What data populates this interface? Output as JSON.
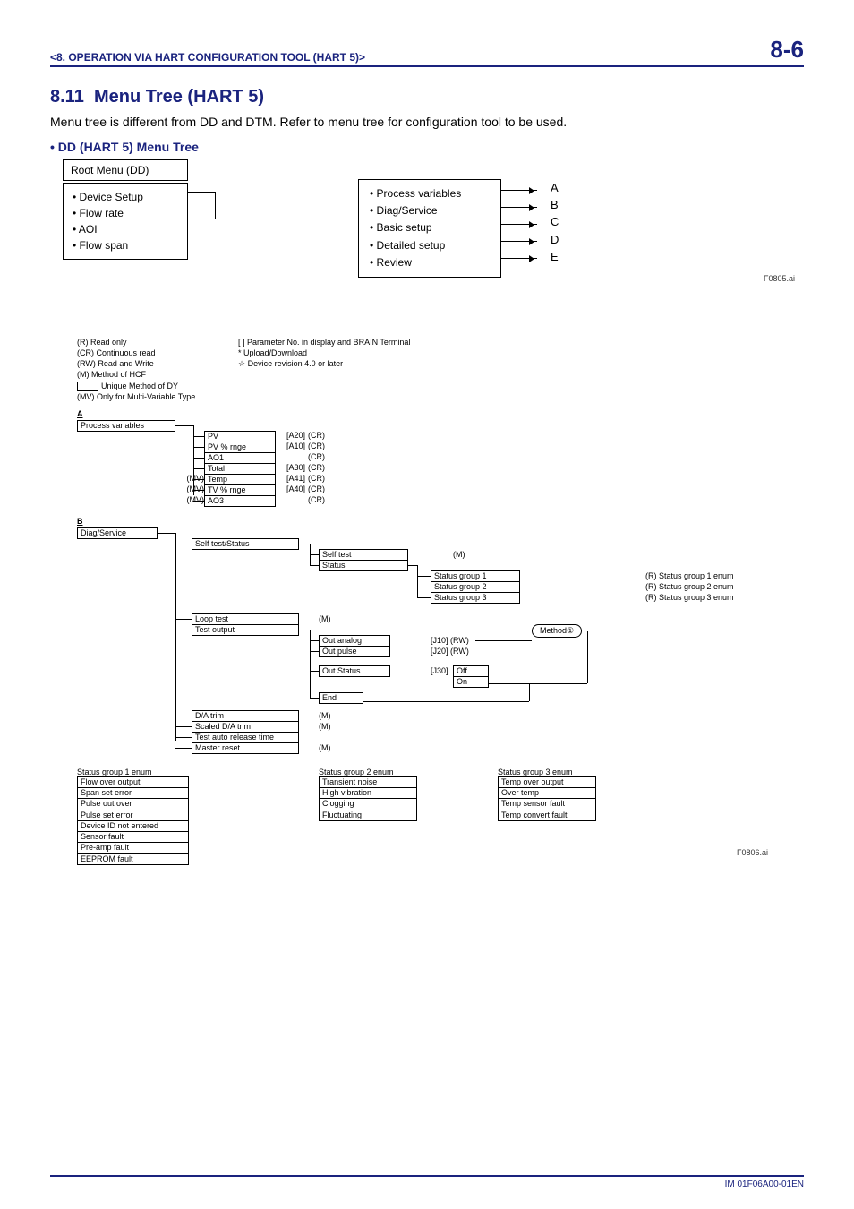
{
  "header": {
    "chapter": "<8.  OPERATION VIA HART CONFIGURATION TOOL (HART 5)>",
    "page": "8-6"
  },
  "section": {
    "num": "8.11",
    "title": "Menu Tree (HART 5)"
  },
  "intro": "Menu tree is different from DD and DTM. Refer to menu tree for configuration tool to be used.",
  "dd_heading": "• DD (HART 5) Menu Tree",
  "root": {
    "title": "Root Menu (DD)",
    "items": [
      "• Device Setup",
      "• Flow rate",
      "• AOI",
      "• Flow span"
    ]
  },
  "device_setup": {
    "items": [
      "• Process variables",
      "• Diag/Service",
      "• Basic setup",
      "• Detailed setup",
      "• Review"
    ],
    "letters": [
      "A",
      "B",
      "C",
      "D",
      "E"
    ]
  },
  "fig_labels": {
    "top": "F0805.ai",
    "bottom": "F0806.ai"
  },
  "legend": {
    "left": [
      "(R) Read only",
      "(CR) Continuous read",
      "(RW) Read and Write",
      "(M) Method of HCF"
    ],
    "left_box": "Unique Method of DY",
    "left_mv": "(MV) Only for Multi-Variable Type",
    "right": [
      "[   ] Parameter No. in display and BRAIN Terminal",
      "*  Upload/Download",
      "☆ Device revision 4.0 or later"
    ]
  },
  "sectionA": {
    "label": "A",
    "title": "Process variables",
    "rows": [
      {
        "mv": "",
        "name": "PV",
        "code": "[A20]",
        "rw": "(CR)"
      },
      {
        "mv": "",
        "name": "PV % rnge",
        "code": "[A10]",
        "rw": "(CR)"
      },
      {
        "mv": "",
        "name": "AO1",
        "code": "",
        "rw": "(CR)"
      },
      {
        "mv": "",
        "name": "Total",
        "code": "[A30]",
        "rw": "(CR)"
      },
      {
        "mv": "(MV)",
        "name": "Temp",
        "code": "[A41]",
        "rw": "(CR)"
      },
      {
        "mv": "(MV)",
        "name": "TV % rnge",
        "code": "[A40]",
        "rw": "(CR)"
      },
      {
        "mv": "(MV)",
        "name": "AO3",
        "code": "",
        "rw": "(CR)"
      }
    ]
  },
  "sectionB": {
    "label": "B",
    "title": "Diag/Service",
    "selftest_status": "Self test/Status",
    "selftest": "Self test",
    "selftest_m": "(M)",
    "status": "Status",
    "status_groups": [
      {
        "n": "Status group 1",
        "r": "(R) Status group 1 enum"
      },
      {
        "n": "Status group 2",
        "r": "(R) Status group 2 enum"
      },
      {
        "n": "Status group 3",
        "r": "(R) Status group 3 enum"
      }
    ],
    "loop_test": "Loop test",
    "loop_test_m": "(M)",
    "test_output": "Test output",
    "out_analog": {
      "n": "Out analog",
      "c": "[J10]",
      "r": "(RW)"
    },
    "out_pulse": {
      "n": "Out pulse",
      "c": "[J20]",
      "r": "(RW)"
    },
    "out_status": {
      "n": "Out Status",
      "c": "[J30]"
    },
    "off": "Off",
    "on": "On",
    "end": "End",
    "method_bubble": "Method①",
    "da_trim": {
      "n": "D/A trim",
      "m": "(M)"
    },
    "scaled_da": {
      "n": "Scaled D/A trim",
      "m": "(M)"
    },
    "test_auto": "Test auto release time",
    "master_reset": {
      "n": "Master reset",
      "m": "(M)"
    },
    "enum1": {
      "title": "Status group 1 enum",
      "items": [
        "Flow over output",
        "Span set error",
        "Pulse out over",
        "Pulse set error",
        "Device ID not entered",
        "Sensor fault",
        "Pre-amp fault",
        "EEPROM fault"
      ]
    },
    "enum2": {
      "title": "Status group 2 enum",
      "items": [
        "Transient noise",
        "High vibration",
        "Clogging",
        "Fluctuating"
      ]
    },
    "enum3": {
      "title": "Status group 3 enum",
      "items": [
        "Temp over output",
        "Over temp",
        "Temp sensor fault",
        "Temp convert fault"
      ]
    }
  },
  "footer": "IM 01F06A00-01EN"
}
